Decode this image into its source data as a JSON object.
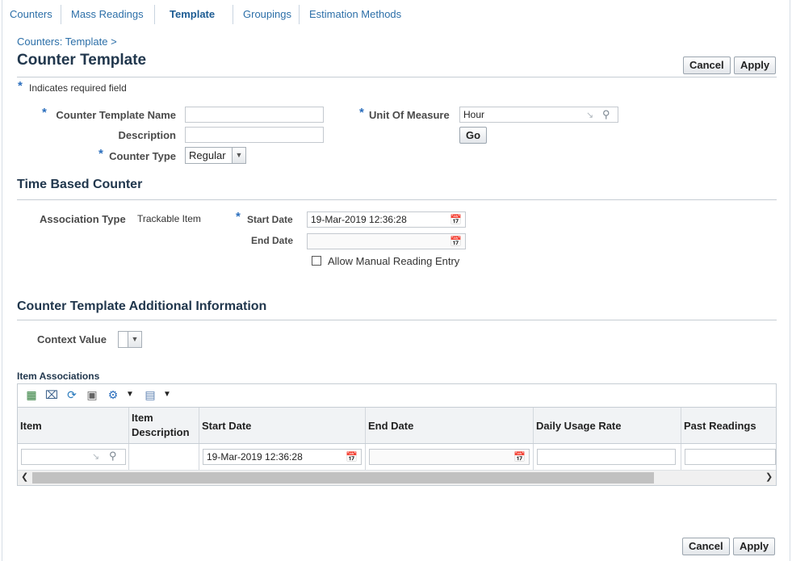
{
  "tabs": [
    {
      "label": "Counters"
    },
    {
      "label": "Mass Readings"
    },
    {
      "label": "Template"
    },
    {
      "label": "Groupings"
    },
    {
      "label": "Estimation Methods"
    }
  ],
  "breadcrumb": "Counters: Template  >",
  "page_title": "Counter Template",
  "buttons": {
    "cancel": "Cancel",
    "apply": "Apply",
    "go": "Go"
  },
  "required_star": "*",
  "required_note": "Indicates required field",
  "form": {
    "counter_template_name": {
      "label": "Counter Template Name",
      "value": ""
    },
    "description": {
      "label": "Description",
      "value": ""
    },
    "counter_type": {
      "label": "Counter Type",
      "value": "Regular"
    },
    "unit_of_measure": {
      "label": "Unit Of Measure",
      "value": "Hour"
    }
  },
  "time_based": {
    "heading": "Time Based Counter",
    "association_type_label": "Association Type",
    "association_type_value": "Trackable Item",
    "start_date_label": "Start Date",
    "start_date_value": "19-Mar-2019 12:36:28",
    "end_date_label": "End Date",
    "end_date_value": "",
    "allow_manual_label": "Allow Manual Reading Entry",
    "allow_manual_checked": false
  },
  "additional": {
    "heading": "Counter Template Additional Information",
    "context_value_label": "Context Value",
    "context_value": ""
  },
  "item_associations": {
    "heading": "Item Associations",
    "toolbar_icons": [
      "add-row-icon",
      "detach-icon",
      "refresh-icon",
      "export-icon",
      "settings-icon",
      "columns-icon"
    ],
    "columns": [
      "Item",
      "Item\nDescription",
      "Start Date",
      "End Date",
      "Daily Usage Rate",
      "Past Readings"
    ],
    "rows": [
      {
        "item": "",
        "item_description": "",
        "start_date": "19-Mar-2019 12:36:28",
        "end_date": "",
        "daily_usage_rate": "",
        "past_readings": ""
      }
    ]
  },
  "colors": {
    "accent": "#2c6fa8",
    "heading": "#21374d",
    "required": "#2a6ebd"
  }
}
